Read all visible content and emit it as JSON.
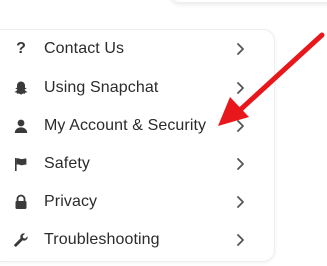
{
  "menu": {
    "items": [
      {
        "label": "Contact Us",
        "icon": "question-mark-icon"
      },
      {
        "label": "Using Snapchat",
        "icon": "ghost-icon"
      },
      {
        "label": "My Account & Security",
        "icon": "user-icon"
      },
      {
        "label": "Safety",
        "icon": "flag-icon"
      },
      {
        "label": "Privacy",
        "icon": "lock-icon"
      },
      {
        "label": "Troubleshooting",
        "icon": "wrench-icon"
      }
    ]
  },
  "colors": {
    "text": "#2b2b2b",
    "icon": "#3a3a3a",
    "chevron": "#555555",
    "arrow": "#e8171b"
  }
}
